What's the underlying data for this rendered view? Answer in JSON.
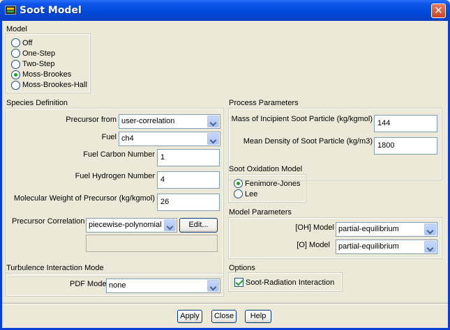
{
  "window": {
    "title": "Soot Model"
  },
  "model": {
    "label": "Model",
    "options": [
      "Off",
      "One-Step",
      "Two-Step",
      "Moss-Brookes",
      "Moss-Brookes-Hall"
    ],
    "selected": "Moss-Brookes"
  },
  "species": {
    "label": "Species Definition",
    "precursor_from_label": "Precursor from",
    "precursor_from_value": "user-correlation",
    "fuel_label": "Fuel",
    "fuel_value": "ch4",
    "fuel_carbon_label": "Fuel Carbon Number",
    "fuel_carbon_value": "1",
    "fuel_hydrogen_label": "Fuel Hydrogen Number",
    "fuel_hydrogen_value": "4",
    "mol_weight_label": "Molecular Weight of Precursor (kg/kgmol)",
    "mol_weight_value": "26",
    "correlation_label": "Precursor Correlation",
    "correlation_value": "piecewise-polynomial",
    "edit_label": "Edit..."
  },
  "process": {
    "label": "Process Parameters",
    "mass_label": "Mass of Incipient Soot Particle (kg/kgmol)",
    "mass_value": "144",
    "density_label": "Mean Density of Soot Particle (kg/m3)",
    "density_value": "1800"
  },
  "oxidation": {
    "label": "Soot Oxidation Model",
    "options": [
      "Fenimore-Jones",
      "Lee"
    ],
    "selected": "Fenimore-Jones"
  },
  "model_params": {
    "label": "Model Parameters",
    "oh_label": "[OH] Model",
    "oh_value": "partial-equilibrium",
    "o_label": "[O] Model",
    "o_value": "partial-equilibrium"
  },
  "turbulence": {
    "label": "Turbulence Interaction Mode",
    "pdf_label": "PDF Mode",
    "pdf_value": "none"
  },
  "options": {
    "label": "Options",
    "soot_radiation_label": "Soot-Radiation Interaction",
    "soot_radiation_checked": true
  },
  "footer": {
    "apply": "Apply",
    "close": "Close",
    "help": "Help"
  },
  "icons": {
    "app": "fluent-app-icon",
    "close": "close-icon"
  }
}
